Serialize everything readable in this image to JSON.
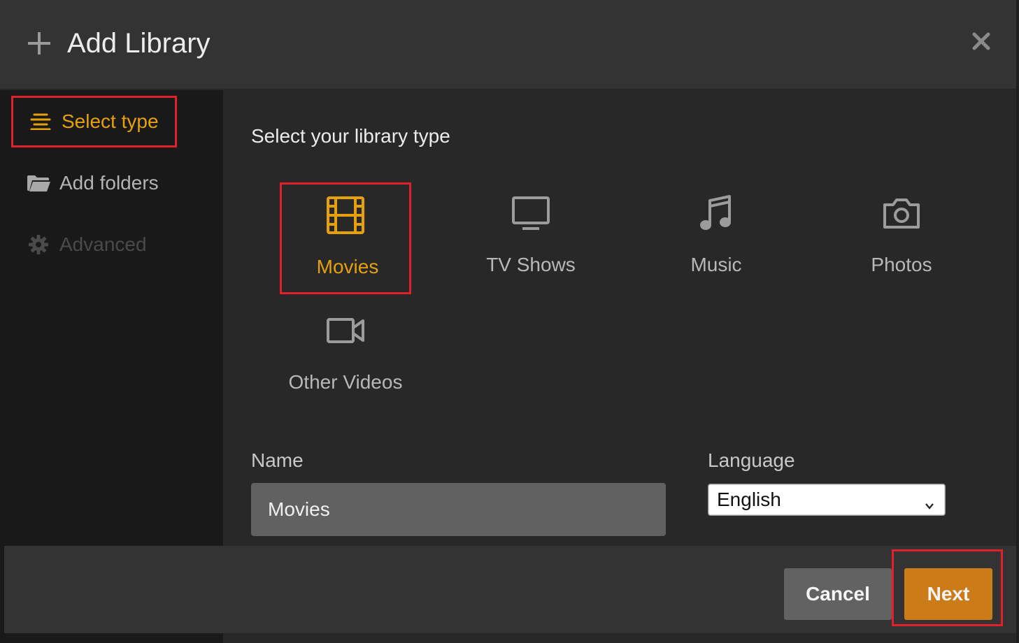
{
  "header": {
    "title": "Add Library",
    "icon": "plus-icon",
    "close_icon": "close-icon"
  },
  "sidebar": {
    "items": [
      {
        "label": "Select type",
        "icon": "list-icon",
        "state": "active"
      },
      {
        "label": "Add folders",
        "icon": "folder-icon",
        "state": "enabled"
      },
      {
        "label": "Advanced",
        "icon": "gear-icon",
        "state": "disabled"
      }
    ]
  },
  "main": {
    "heading": "Select your library type",
    "types": [
      {
        "label": "Movies",
        "icon": "film-icon",
        "selected": true
      },
      {
        "label": "TV Shows",
        "icon": "tv-icon",
        "selected": false
      },
      {
        "label": "Music",
        "icon": "music-note-icon",
        "selected": false
      },
      {
        "label": "Photos",
        "icon": "camera-icon",
        "selected": false
      },
      {
        "label": "Other Videos",
        "icon": "video-camera-icon",
        "selected": false
      }
    ],
    "name": {
      "label": "Name",
      "value": "Movies"
    },
    "language": {
      "label": "Language",
      "value": "English"
    }
  },
  "footer": {
    "cancel_label": "Cancel",
    "next_label": "Next"
  },
  "colors": {
    "accent": "#e5a00d",
    "next_button": "#cc7b19",
    "highlight": "#e0202a"
  }
}
